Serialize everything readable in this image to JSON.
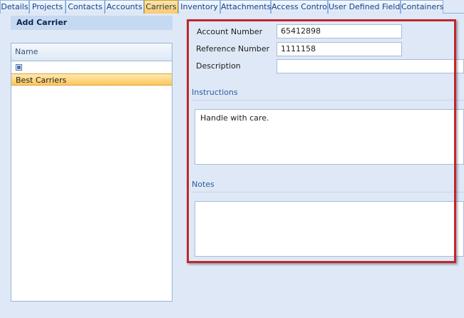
{
  "tabs": [
    {
      "label": "Details",
      "active": false
    },
    {
      "label": "Projects",
      "active": false
    },
    {
      "label": "Contacts",
      "active": false
    },
    {
      "label": "Accounts",
      "active": false
    },
    {
      "label": "Carriers",
      "active": true
    },
    {
      "label": "Inventory",
      "active": false
    },
    {
      "label": "Attachments",
      "active": false
    },
    {
      "label": "Access Control",
      "active": false
    },
    {
      "label": "User Defined Fields",
      "active": false
    },
    {
      "label": "Containers",
      "active": false
    }
  ],
  "left_panel": {
    "add_button_label": "Add Carrier",
    "list": {
      "column_header": "Name",
      "rows": [
        {
          "name": "Best Carriers",
          "selected": true
        }
      ]
    }
  },
  "form": {
    "account_number": {
      "label": "Account Number",
      "value": "65412898"
    },
    "reference_number": {
      "label": "Reference Number",
      "value": "1111158"
    },
    "description": {
      "label": "Description",
      "value": ""
    },
    "instructions": {
      "title": "Instructions",
      "value": "Handle with care."
    },
    "notes": {
      "title": "Notes",
      "value": ""
    }
  },
  "colors": {
    "accent": "#15428b",
    "active_tab": "#ffc86a",
    "highlight_border": "#c0272d"
  }
}
